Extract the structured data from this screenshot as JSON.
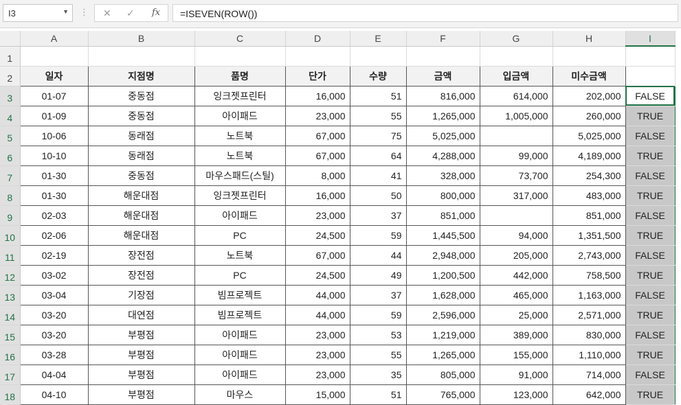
{
  "formula_bar": {
    "name_box": "I3",
    "formula": "=ISEVEN(ROW())",
    "cancel_icon": "✕",
    "enter_icon": "✓",
    "fx_label": "fx"
  },
  "columns": [
    "A",
    "B",
    "C",
    "D",
    "E",
    "F",
    "G",
    "H",
    "I"
  ],
  "rows": [
    "1",
    "2",
    "3",
    "4",
    "5",
    "6",
    "7",
    "8",
    "9",
    "10",
    "11",
    "12",
    "13",
    "14",
    "15",
    "16",
    "17",
    "18"
  ],
  "headers": [
    "일자",
    "지점명",
    "품명",
    "단가",
    "수량",
    "금액",
    "입금액",
    "미수금액"
  ],
  "data": [
    [
      "01-07",
      "중동점",
      "잉크젯프린터",
      "16,000",
      "51",
      "816,000",
      "614,000",
      "202,000",
      "FALSE"
    ],
    [
      "01-09",
      "중동점",
      "아이패드",
      "23,000",
      "55",
      "1,265,000",
      "1,005,000",
      "260,000",
      "TRUE"
    ],
    [
      "10-06",
      "동래점",
      "노트북",
      "67,000",
      "75",
      "5,025,000",
      "",
      "5,025,000",
      "FALSE"
    ],
    [
      "10-10",
      "동래점",
      "노트북",
      "67,000",
      "64",
      "4,288,000",
      "99,000",
      "4,189,000",
      "TRUE"
    ],
    [
      "01-30",
      "중동점",
      "마우스패드(스틸)",
      "8,000",
      "41",
      "328,000",
      "73,700",
      "254,300",
      "FALSE"
    ],
    [
      "01-30",
      "해운대점",
      "잉크젯프린터",
      "16,000",
      "50",
      "800,000",
      "317,000",
      "483,000",
      "TRUE"
    ],
    [
      "02-03",
      "해운대점",
      "아이패드",
      "23,000",
      "37",
      "851,000",
      "",
      "851,000",
      "FALSE"
    ],
    [
      "02-06",
      "해운대점",
      "PC",
      "24,500",
      "59",
      "1,445,500",
      "94,000",
      "1,351,500",
      "TRUE"
    ],
    [
      "02-19",
      "장전점",
      "노트북",
      "67,000",
      "44",
      "2,948,000",
      "205,000",
      "2,743,000",
      "FALSE"
    ],
    [
      "03-02",
      "장전점",
      "PC",
      "24,500",
      "49",
      "1,200,500",
      "442,000",
      "758,500",
      "TRUE"
    ],
    [
      "03-04",
      "기장점",
      "빔프로젝트",
      "44,000",
      "37",
      "1,628,000",
      "465,000",
      "1,163,000",
      "FALSE"
    ],
    [
      "03-20",
      "대연점",
      "빔프로젝트",
      "44,000",
      "59",
      "2,596,000",
      "25,000",
      "2,571,000",
      "TRUE"
    ],
    [
      "03-20",
      "부평점",
      "아이패드",
      "23,000",
      "53",
      "1,219,000",
      "389,000",
      "830,000",
      "FALSE"
    ],
    [
      "03-28",
      "부평점",
      "아이패드",
      "23,000",
      "55",
      "1,265,000",
      "155,000",
      "1,110,000",
      "TRUE"
    ],
    [
      "04-04",
      "부평점",
      "아이패드",
      "23,000",
      "35",
      "805,000",
      "91,000",
      "714,000",
      "FALSE"
    ],
    [
      "04-10",
      "부평점",
      "마우스",
      "15,000",
      "51",
      "765,000",
      "123,000",
      "642,000",
      "TRUE"
    ]
  ]
}
